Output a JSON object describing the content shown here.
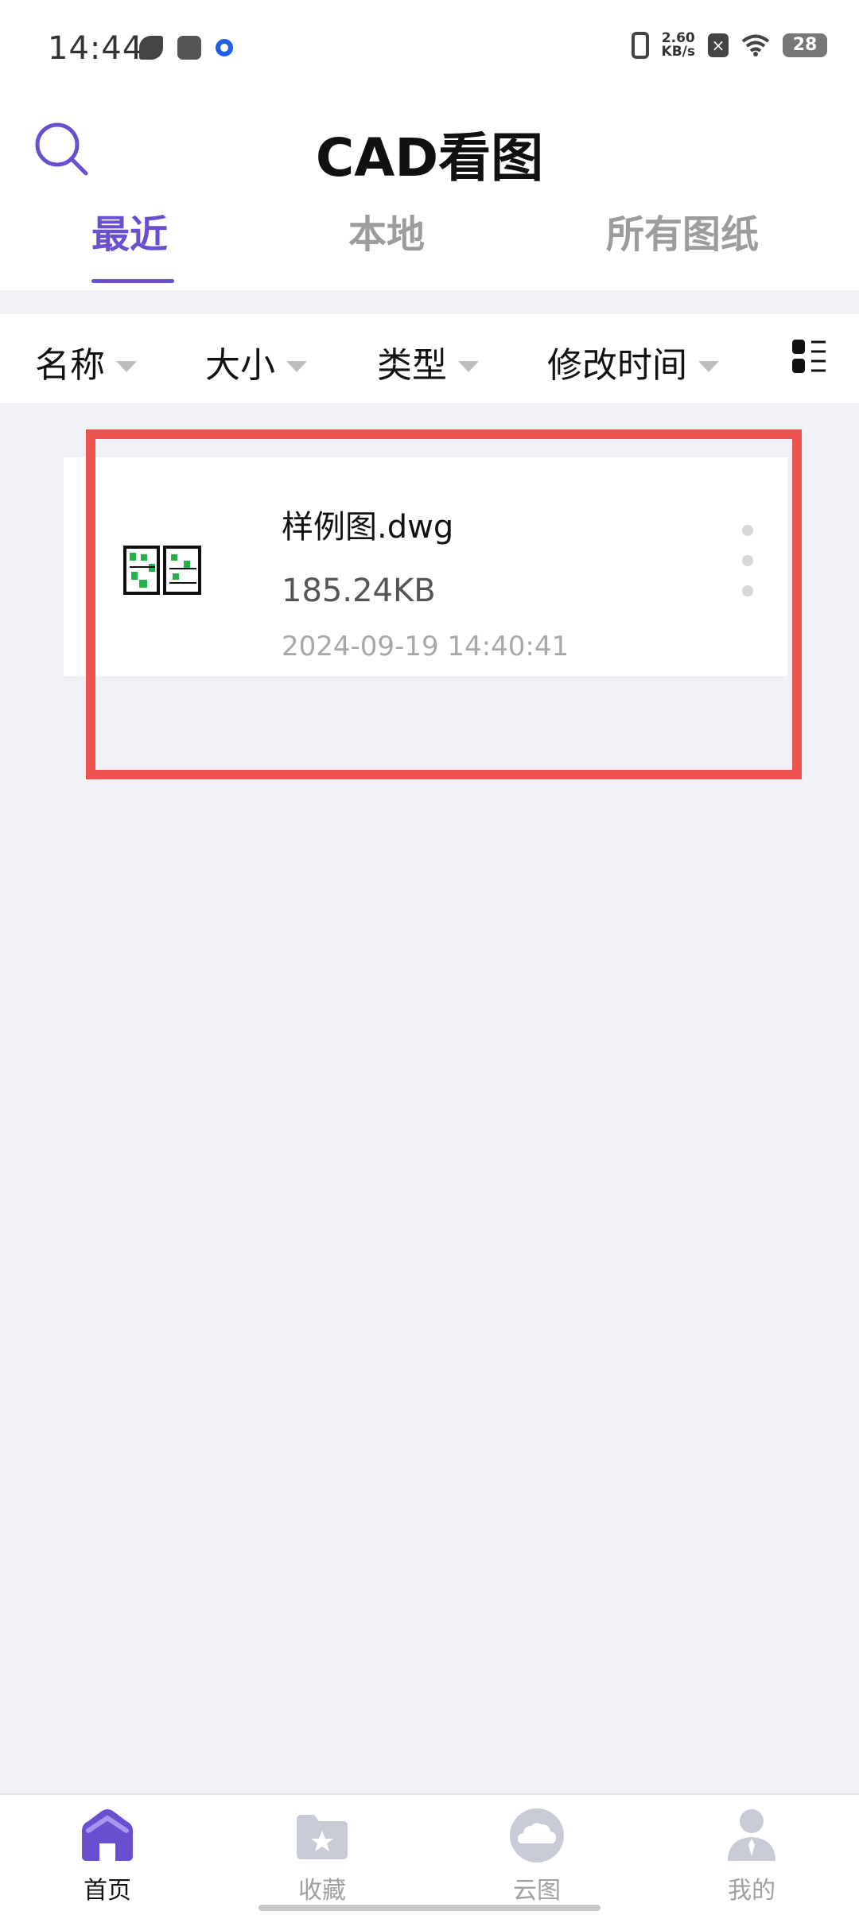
{
  "status_bar": {
    "time": "14:44",
    "net_speed_value": "2.60",
    "net_speed_unit": "KB/s",
    "battery": "28"
  },
  "header": {
    "title": "CAD看图"
  },
  "tabs": [
    {
      "label": "最近",
      "active": true
    },
    {
      "label": "本地",
      "active": false
    },
    {
      "label": "所有图纸",
      "active": false
    }
  ],
  "sort_bar": {
    "name": "名称",
    "size": "大小",
    "type": "类型",
    "modified": "修改时间"
  },
  "files": [
    {
      "name": "样例图.dwg",
      "size": "185.24KB",
      "modified": "2024-09-19 14:40:41"
    }
  ],
  "bottom_nav": [
    {
      "label": "首页",
      "icon": "home-icon",
      "active": true
    },
    {
      "label": "收藏",
      "icon": "favorites-folder-icon",
      "active": false
    },
    {
      "label": "云图",
      "icon": "cloud-icon",
      "active": false
    },
    {
      "label": "我的",
      "icon": "profile-icon",
      "active": false
    }
  ],
  "colors": {
    "accent": "#6a4fd0",
    "highlight": "#ef5350",
    "background": "#f0f1f5"
  }
}
